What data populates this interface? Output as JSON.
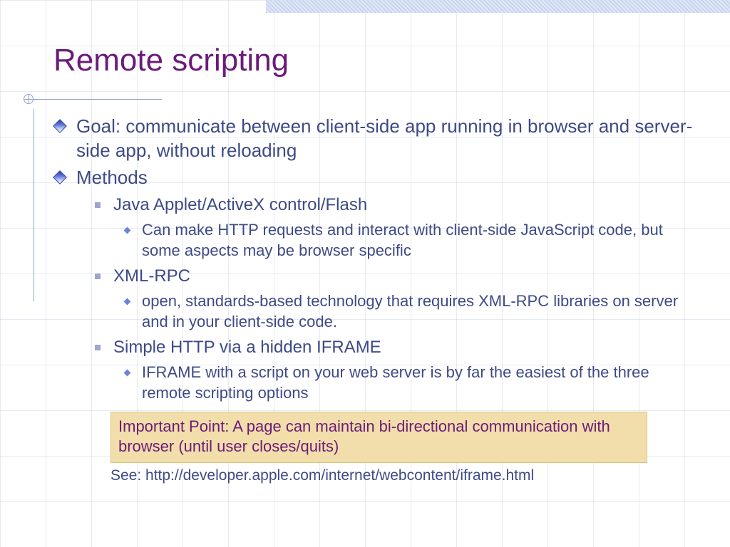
{
  "title": "Remote scripting",
  "bullets": {
    "b0": "Goal: communicate between client-side app running in browser and server-side app, without reloading",
    "b1": "Methods",
    "m0": "Java Applet/ActiveX control/Flash",
    "m0d": "Can make HTTP requests and interact with client-side JavaScript code,  but some aspects may be browser specific",
    "m1": "XML-RPC",
    "m1d": "open, standards-based technology that requires XML-RPC libraries on server and in your client-side code.",
    "m2": "Simple HTTP via a hidden IFRAME",
    "m2d": "IFRAME with a script on your web server is by far the easiest of the three remote scripting options"
  },
  "callout": "Important Point: A page can maintain bi-directional communication with browser (until user closes/quits)",
  "see": "See:  http://developer.apple.com/internet/webcontent/iframe.html"
}
